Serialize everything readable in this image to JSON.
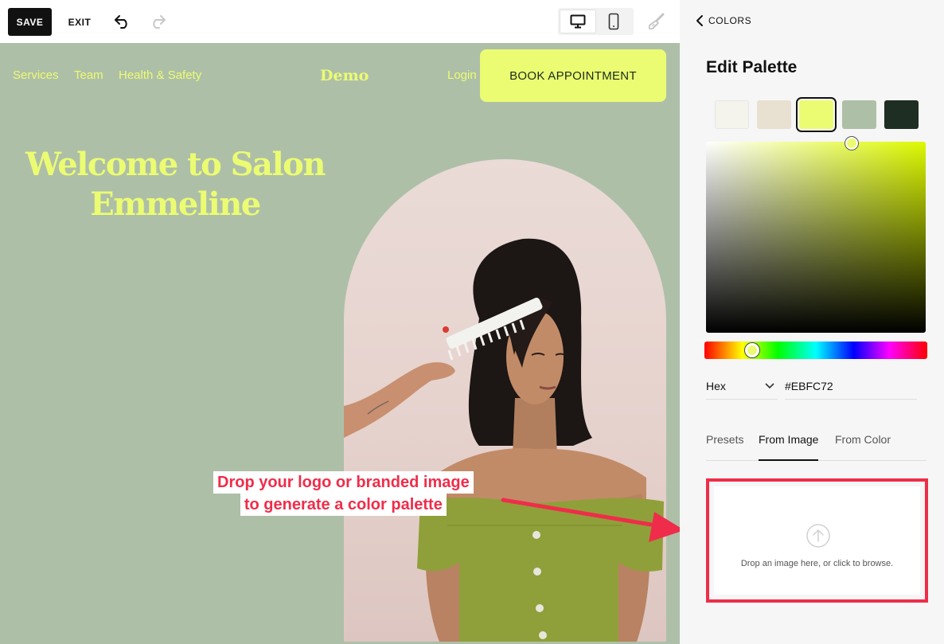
{
  "toolbar": {
    "save_label": "SAVE",
    "exit_label": "EXIT"
  },
  "site": {
    "nav": [
      "Services",
      "Team",
      "Health & Safety"
    ],
    "logo": "Demo",
    "login": "Login",
    "cta": "BOOK APPOINTMENT",
    "hero_title_line1": "Welcome to Salon",
    "hero_title_line2": "Emmeline",
    "colors": {
      "background": "#aebfa8",
      "accent": "#ebfc72"
    }
  },
  "callout": {
    "line1": "Drop your logo or branded image",
    "line2": "to generate a color palette"
  },
  "panel": {
    "back_label": "COLORS",
    "title": "Edit Palette",
    "swatches": [
      "#f4f4ec",
      "#e8e0d0",
      "#ebfc72",
      "#aebfa8",
      "#1f2e22"
    ],
    "selected_swatch": 2,
    "color_format": "Hex",
    "hex_value": "#EBFC72",
    "tabs": [
      "Presets",
      "From Image",
      "From Color"
    ],
    "active_tab": "From Image",
    "dropzone_text": "Drop an image here, or click to browse."
  }
}
